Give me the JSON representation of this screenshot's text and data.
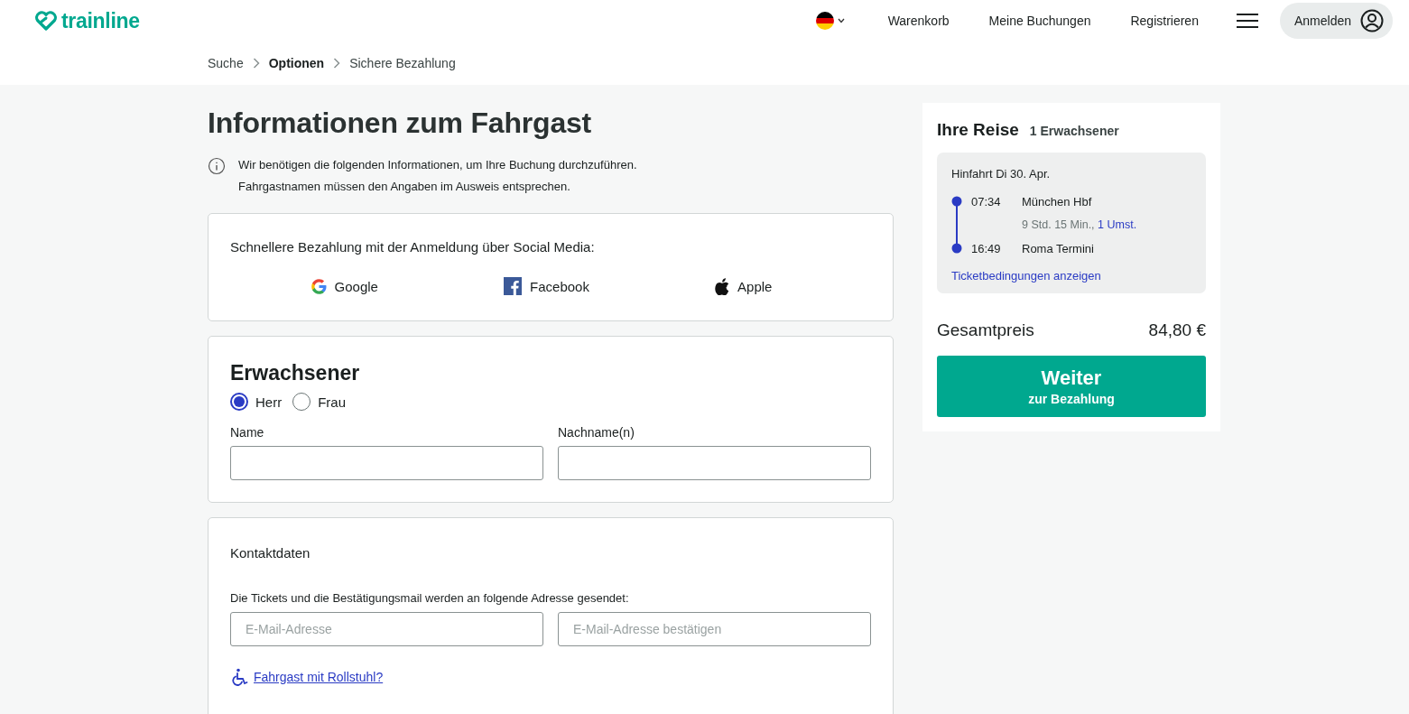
{
  "header": {
    "logo": "trainline",
    "nav": [
      "Warenkorb",
      "Meine Buchungen",
      "Registrieren"
    ],
    "login_button": "Anmelden"
  },
  "breadcrumb": [
    {
      "label": "Suche",
      "selected": false
    },
    {
      "label": "Optionen",
      "selected": true
    },
    {
      "label": "Sichere Bezahlung",
      "selected": false
    }
  ],
  "title": "Informationen zum Fahrgast",
  "info": [
    "Wir benötigen die folgenden Informationen, um Ihre Buchung durchzuführen.",
    "Fahrgastnamen müssen den Angaben im Ausweis entsprechen."
  ],
  "social": {
    "heading": "Schnellere Bezahlung mit der Anmeldung über Social Media:",
    "providers": [
      {
        "kind": "google",
        "label": "Google"
      },
      {
        "kind": "facebook",
        "label": "Facebook"
      },
      {
        "kind": "apple",
        "label": "Apple"
      }
    ]
  },
  "passenger": {
    "heading": "Erwachsener",
    "salutations": [
      {
        "label": "Herr",
        "selected": true
      },
      {
        "label": "Frau",
        "selected": false
      }
    ],
    "fields": [
      {
        "label": "Name"
      },
      {
        "label": "Nachname(n)"
      }
    ]
  },
  "contact": {
    "heading": "Kontaktdaten",
    "note": "Die Tickets und die Bestätigungsmail werden an folgende Adresse gesendet:",
    "fields": [
      {
        "placeholder": "E-Mail-Adresse"
      },
      {
        "placeholder": "E-Mail-Adresse bestätigen"
      }
    ],
    "link": "Fahrgast mit Rollstuhl?"
  },
  "summary": {
    "title": "Ihre Reise",
    "passengers": "1 Erwachsener",
    "journey": {
      "heading": "Hinfahrt Di 30. Apr.",
      "departure": {
        "time": "07:34",
        "station": "München Hbf"
      },
      "duration": "9 Std. 15 Min.,",
      "changes": "1 Umst.",
      "arrival": {
        "time": "16:49",
        "station": "Roma Termini"
      },
      "conditions_link": "Ticketbedingungen anzeigen"
    },
    "total_label": "Gesamtpreis",
    "total": "84,80 €",
    "button": {
      "title": "Weiter",
      "subtitle": "zur Bezahlung"
    }
  }
}
